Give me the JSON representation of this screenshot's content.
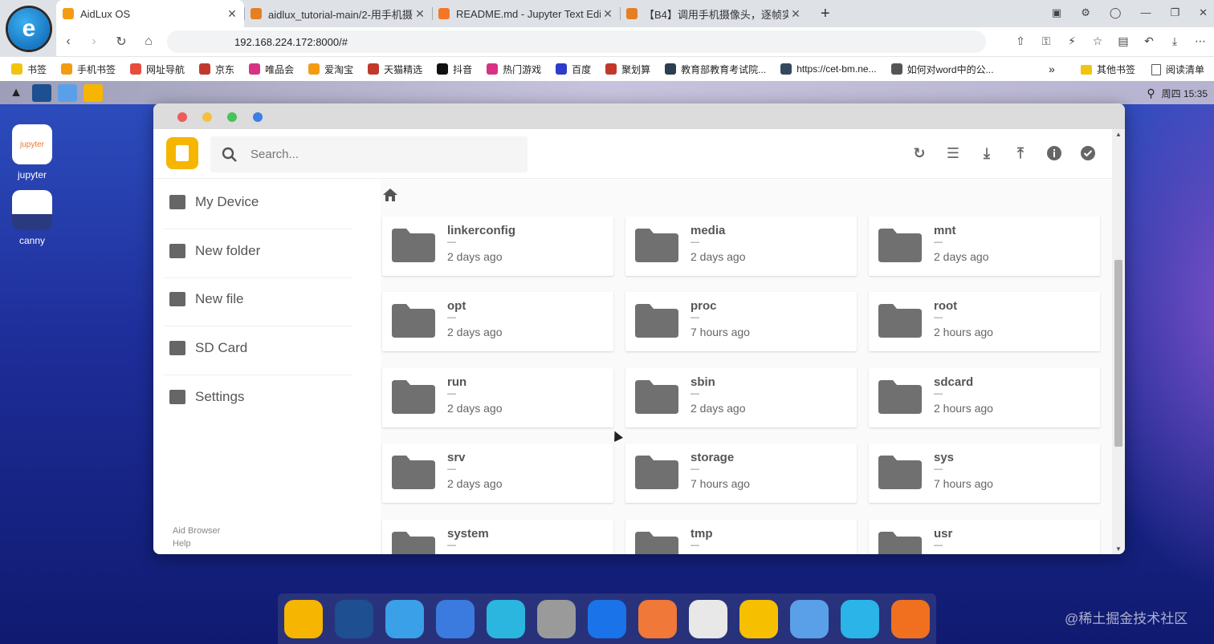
{
  "browser": {
    "tabs": [
      {
        "title": "AidLux OS",
        "color": "#f39c12",
        "active": true
      },
      {
        "title": "aidlux_tutorial-main/2-用手机摄",
        "color": "#e67e22",
        "active": false
      },
      {
        "title": "README.md - Jupyter Text Edi",
        "color": "#f37726",
        "active": false
      },
      {
        "title": "【B4】调用手机摄像头，逐帧实",
        "color": "#e67e22",
        "active": false
      }
    ],
    "new_tab": "+",
    "url": "192.168.224.172:8000/#",
    "bookmarks": [
      {
        "label": "书签",
        "color": "#f1c40f"
      },
      {
        "label": "手机书签",
        "color": "#f39c12"
      },
      {
        "label": "网址导航",
        "color": "#e74c3c"
      },
      {
        "label": "京东",
        "color": "#c0392b"
      },
      {
        "label": "唯品会",
        "color": "#d63384"
      },
      {
        "label": "爱淘宝",
        "color": "#f39c12"
      },
      {
        "label": "天猫精选",
        "color": "#c0392b"
      },
      {
        "label": "抖音",
        "color": "#111111"
      },
      {
        "label": "热门游戏",
        "color": "#d63384"
      },
      {
        "label": "百度",
        "color": "#2e3cc9"
      },
      {
        "label": "聚划算",
        "color": "#c0392b"
      },
      {
        "label": "教育部教育考试院...",
        "color": "#2c3e50"
      },
      {
        "label": "https://cet-bm.ne...",
        "color": "#34495e"
      },
      {
        "label": "如何对word中的公...",
        "color": "#555555"
      }
    ],
    "bookmarks_more": "»",
    "other_bookmarks": "其他书签",
    "reading_list": "阅读清单"
  },
  "os": {
    "clock": "周四 15:35",
    "desktop_icons": [
      {
        "label": "jupyter",
        "badge": "jupyter"
      },
      {
        "label": "canny",
        "badge": ""
      }
    ]
  },
  "file_manager": {
    "search_placeholder": "Search...",
    "sidebar": [
      {
        "label": "My Device",
        "icon": "folder-icon"
      },
      {
        "label": "New folder",
        "icon": "new-folder-icon"
      },
      {
        "label": "New file",
        "icon": "new-file-icon"
      },
      {
        "label": "SD Card",
        "icon": "sd-card-icon"
      },
      {
        "label": "Settings",
        "icon": "settings-icon"
      }
    ],
    "links": [
      "Aid Browser",
      "Help"
    ],
    "toolbar_icons": [
      "refresh-icon",
      "list-view-icon",
      "download-icon",
      "upload-icon",
      "info-icon",
      "select-icon"
    ],
    "items": [
      {
        "name": "linkerconfig",
        "size": "—",
        "modified": "2 days ago"
      },
      {
        "name": "media",
        "size": "—",
        "modified": "2 days ago"
      },
      {
        "name": "mnt",
        "size": "—",
        "modified": "2 days ago"
      },
      {
        "name": "opt",
        "size": "—",
        "modified": "2 days ago"
      },
      {
        "name": "proc",
        "size": "—",
        "modified": "7 hours ago"
      },
      {
        "name": "root",
        "size": "—",
        "modified": "2 hours ago"
      },
      {
        "name": "run",
        "size": "—",
        "modified": "2 days ago"
      },
      {
        "name": "sbin",
        "size": "—",
        "modified": "2 days ago"
      },
      {
        "name": "sdcard",
        "size": "—",
        "modified": "2 hours ago"
      },
      {
        "name": "srv",
        "size": "—",
        "modified": "2 days ago"
      },
      {
        "name": "storage",
        "size": "—",
        "modified": "7 hours ago"
      },
      {
        "name": "sys",
        "size": "—",
        "modified": "7 hours ago"
      },
      {
        "name": "system",
        "size": "—",
        "modified": ""
      },
      {
        "name": "tmp",
        "size": "—",
        "modified": ""
      },
      {
        "name": "usr",
        "size": "—",
        "modified": ""
      }
    ]
  },
  "dock": [
    {
      "name": "files-app",
      "color": "#f6b500"
    },
    {
      "name": "terminal-app",
      "color": "#1d4f91"
    },
    {
      "name": "browser-app",
      "color": "#3aa0e8"
    },
    {
      "name": "code-app",
      "color": "#3b7be0"
    },
    {
      "name": "cloud-app",
      "color": "#2bb6e0"
    },
    {
      "name": "settings-app",
      "color": "#9a9a9a"
    },
    {
      "name": "appstore-app",
      "color": "#1a73e8"
    },
    {
      "name": "bulb-app",
      "color": "#f07838"
    },
    {
      "name": "calculator-app",
      "color": "#e8e8e8"
    },
    {
      "name": "touch-app",
      "color": "#f6c000"
    },
    {
      "name": "tools-app",
      "color": "#5aa0e8"
    },
    {
      "name": "bird-app",
      "color": "#2ab4e8"
    },
    {
      "name": "aidlux-app",
      "color": "#f07020"
    }
  ],
  "watermark": "@稀土掘金技术社区"
}
